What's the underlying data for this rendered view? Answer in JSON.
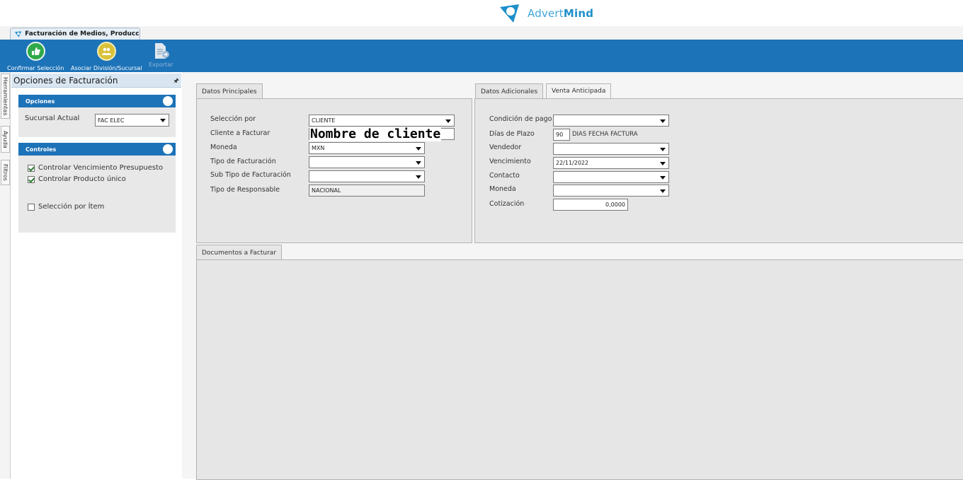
{
  "brand": {
    "name_light": "Advert",
    "name_bold": "Mind"
  },
  "doc_tab": {
    "title": "Facturación de Medios, Producci..."
  },
  "toolbar": {
    "confirm_label": "Confirmar Selección",
    "associate_label": "Asociar División/Sucursal",
    "export_label": "Exportar"
  },
  "side_tabs": {
    "tools": "Herramientas",
    "help": "Ayuda",
    "filters": "Filtros"
  },
  "left_panel": {
    "title": "Opciones de Facturación",
    "options_group": {
      "title": "Opciones",
      "branch_label": "Sucursal Actual",
      "branch_value": "FAC ELEC"
    },
    "controls_group": {
      "title": "Controles",
      "check_budget": "Controlar Vencimiento Presupuesto",
      "check_budget_checked": true,
      "check_product": "Controlar Producto único",
      "check_product_checked": true,
      "check_item": "Selección por Ítem",
      "check_item_checked": false
    }
  },
  "main_data": {
    "tab": "Datos Principales",
    "selection_label": "Selección por",
    "selection_value": "CLIENTE",
    "client_label": "Cliente a Facturar",
    "client_value": "Nombre de cliente",
    "currency_label": "Moneda",
    "currency_value": "MXN",
    "billing_type_label": "Tipo de Facturación",
    "billing_type_value": "",
    "billing_subtype_label": "Sub Tipo de Facturación",
    "billing_subtype_value": "",
    "responsible_type_label": "Tipo de Responsable",
    "responsible_type_value": "NACIONAL"
  },
  "additional_data": {
    "tab_additional": "Datos Adicionales",
    "tab_advance": "Venta Anticipada",
    "payment_label": "Condición de pago",
    "payment_value": "",
    "term_days_label": "Días de Plazo",
    "term_days_value": "90",
    "term_days_suffix": "DIAS FECHA FACTURA",
    "seller_label": "Vendedor",
    "seller_value": "",
    "due_label": "Vencimiento",
    "due_value": "22/11/2022",
    "contact_label": "Contacto",
    "contact_value": "",
    "currency_label": "Moneda",
    "currency_value": "",
    "quote_label": "Cotización",
    "quote_value": "0,0000"
  },
  "documents": {
    "tab": "Documentos a Facturar"
  },
  "colors": {
    "ribbon": "#1d73b8",
    "panel_bg": "#e6e6e6",
    "brand": "#1e8fc9"
  }
}
